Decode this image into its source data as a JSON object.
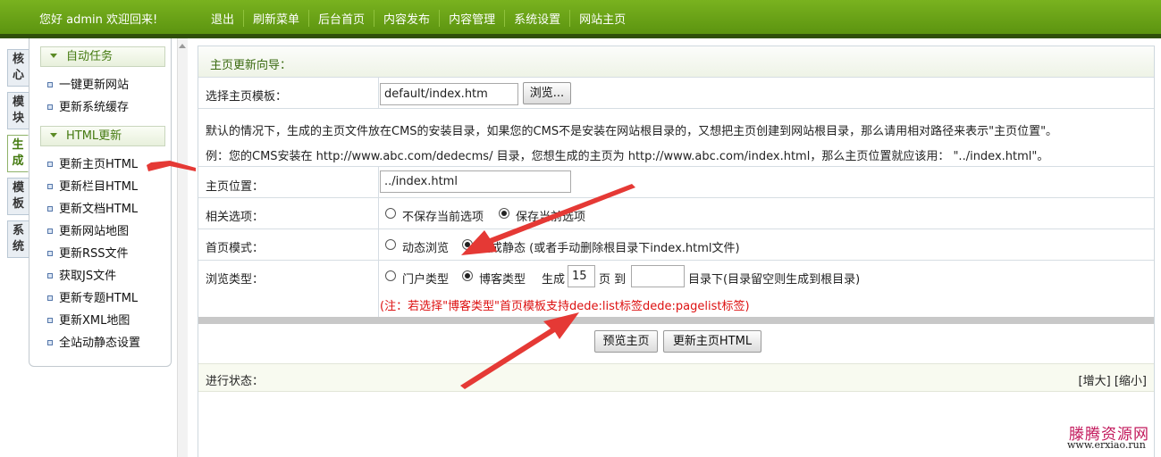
{
  "header": {
    "welcome": "您好 admin 欢迎回来!",
    "nav": [
      "退出",
      "刷新菜单",
      "后台首页",
      "内容发布",
      "内容管理",
      "系统设置",
      "网站主页"
    ]
  },
  "side_tabs": [
    {
      "label": "核心",
      "active": false
    },
    {
      "label": "模块",
      "active": false
    },
    {
      "label": "生成",
      "active": true
    },
    {
      "label": "模板",
      "active": false
    },
    {
      "label": "系统",
      "active": false
    }
  ],
  "menu": {
    "group1": "自动任务",
    "group1_items": [
      "一键更新网站",
      "更新系统缓存"
    ],
    "group2": "HTML更新",
    "group2_items": [
      "更新主页HTML",
      "更新栏目HTML",
      "更新文档HTML",
      "更新网站地图",
      "更新RSS文件",
      "获取JS文件",
      "更新专题HTML",
      "更新XML地图",
      "全站动静态设置"
    ]
  },
  "form": {
    "title": "主页更新向导：",
    "template_label": "选择主页模板：",
    "template_value": "default/index.htm",
    "browse_btn": "浏览...",
    "desc1": "默认的情况下，生成的主页文件放在CMS的安装目录，如果您的CMS不是安装在网站根目录的，又想把主页创建到网站根目录，那么请用相对路径来表示\"主页位置\"。",
    "desc2": "例：您的CMS安装在 http://www.abc.com/dedecms/ 目录，您想生成的主页为 http://www.abc.com/index.html，那么主页位置就应该用：  \"../index.html\"。",
    "position_label": "主页位置：",
    "position_value": "../index.html",
    "options_label": "相关选项：",
    "opt_no_save": "不保存当前选项",
    "opt_save": "保存当前选项",
    "mode_label": "首页模式：",
    "mode_dynamic": "动态浏览",
    "mode_static": "生成静态 (或者手动删除根目录下index.html文件)",
    "browse_type_label": "浏览类型：",
    "type_portal": "门户类型",
    "type_blog": "博客类型",
    "gen_text": "生成",
    "pages_value": "15",
    "pages_to": "页 到",
    "dir_value": "",
    "dir_note": "目录下(目录留空则生成到根目录)",
    "warning": "(注：若选择\"博客类型\"首页模板支持dede:list标签dede:pagelist标签)",
    "preview_btn": "预览主页",
    "update_btn": "更新主页HTML",
    "status_label": "进行状态：",
    "zoom_in": "[增大]",
    "zoom_out": "[缩小]"
  },
  "watermark": {
    "cn": "滕腾资源网",
    "url": "www.erxiao.run"
  },
  "colors": {
    "brand_green": "#6aa418",
    "annotation_arrow": "#e53935",
    "warning_text": "#dd1111"
  }
}
